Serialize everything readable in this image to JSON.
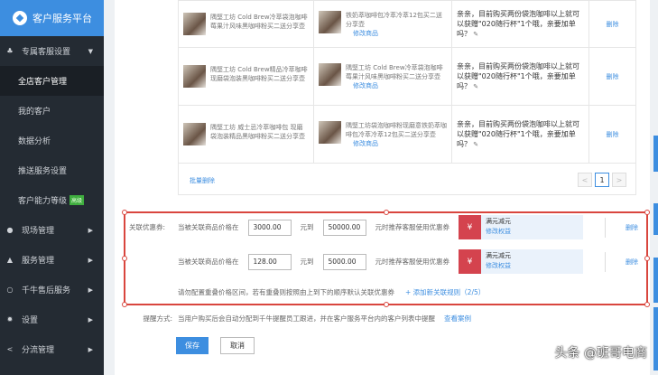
{
  "sidebar": {
    "brand": "客户服务平台",
    "items": [
      {
        "label": "专属客服设置",
        "icon": "users-icon",
        "arrow": "▼"
      },
      {
        "label": "全店客户管理"
      },
      {
        "label": "我的客户"
      },
      {
        "label": "数据分析"
      },
      {
        "label": "推送服务设置"
      },
      {
        "label": "客户能力等级",
        "badge": "高级"
      },
      {
        "label": "现场管理",
        "icon": "location-icon",
        "arrow": "▶"
      },
      {
        "label": "服务管理",
        "icon": "bell-icon",
        "arrow": "▶"
      },
      {
        "label": "千牛售后服务",
        "icon": "circle-icon",
        "arrow": "▶"
      },
      {
        "label": "设置",
        "icon": "gear-icon",
        "arrow": "▶"
      },
      {
        "label": "分流管理",
        "icon": "share-icon",
        "arrow": "▶"
      }
    ]
  },
  "table": {
    "rows": [
      {
        "product": "隅堅工坊 Cold Brew冷萃袋泡咖啡莓果汁风味黑咖啡粉买二送分享壶",
        "gift": "铁奶萃咖啡包冷萃冷萃12包买二送分享壶",
        "edit": "修改商品",
        "message": "亲亲，目前购买两份袋泡咖啡以上就可以获赠\"020随行杯\"1个哦，亲要加单吗？",
        "delete": "删除"
      },
      {
        "product": "隅堅工坊 Cold Brew精品冷萃咖啡现磨袋泡装黑咖啡粉买二送分享壶",
        "gift": "隅堅工坊 Cold Brew冷萃袋泡咖啡莓果汁风味黑咖啡粉买二送分享壶",
        "edit": "修改商品",
        "message": "亲亲，目前购买两份袋泡咖啡以上就可以获赠\"020随行杯\"1个哦，亲要加单吗？",
        "delete": "删除"
      },
      {
        "product": "隅堅工坊 威士忌冷萃咖啡包 现磨袋泡装精品黑咖啡粉买二送分享壶",
        "gift": "隅堅工坊袋泡咖啡粉现磨意铁奶萃咖啡包冷萃冷萃12包买二送分享壶",
        "edit": "修改商品",
        "message": "亲亲，目前购买两份袋泡咖啡以上就可以获赠\"020随行杯\"1个哦，亲要加单吗？",
        "delete": "删除"
      }
    ],
    "batch_delete": "批量删除",
    "page": "1",
    "prev": "<",
    "next": ">"
  },
  "coupon_rules": {
    "label": "关联优惠券:",
    "rules": [
      {
        "prefix": "当被关联商品价格在",
        "min": "3000.00",
        "mid": "元到",
        "max": "50000.00",
        "suffix": "元时推荐客服使用优惠券",
        "coupon": "满元减元",
        "edit": "修改权益",
        "delete": "删除"
      },
      {
        "prefix": "当被关联商品价格在",
        "min": "128.00",
        "mid": "元到",
        "max": "5000.00",
        "suffix": "元时推荐客服使用优惠券",
        "coupon": "满元减元",
        "edit": "修改权益",
        "delete": "删除"
      }
    ],
    "note": "请勿配置重叠价格区间，若有重叠则按照由上到下的顺序默认关联优惠券",
    "add": "+ 添加新关联规则（2/5）",
    "coupon_icon": "¥"
  },
  "reminder": {
    "label": "提醒方式:",
    "text": "当用户购买后会自动分配到千牛提醒员工跟进，并在客户服务平台内的客户列表中提醒",
    "link": "查看案例"
  },
  "actions": {
    "save": "保存",
    "cancel": "取消"
  },
  "watermark": "头条 @班哥电商"
}
